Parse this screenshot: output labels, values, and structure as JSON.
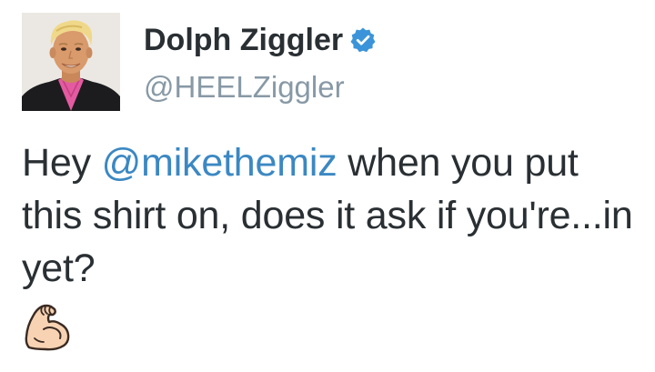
{
  "tweet": {
    "author": {
      "name": "Dolph Ziggler",
      "handle": "@HEELZiggler",
      "verified": true,
      "avatar_icon": "profile-photo"
    },
    "text": {
      "part1": "Hey ",
      "mention": "@mikethemiz",
      "part2": " when you put this shirt on, does it ask if you're...in yet?"
    },
    "emoji": "flexed-biceps-icon",
    "colors": {
      "text": "#292f33",
      "handle": "#8899a6",
      "mention": "#3b88c3",
      "verified_badge": "#3b94d9"
    }
  }
}
